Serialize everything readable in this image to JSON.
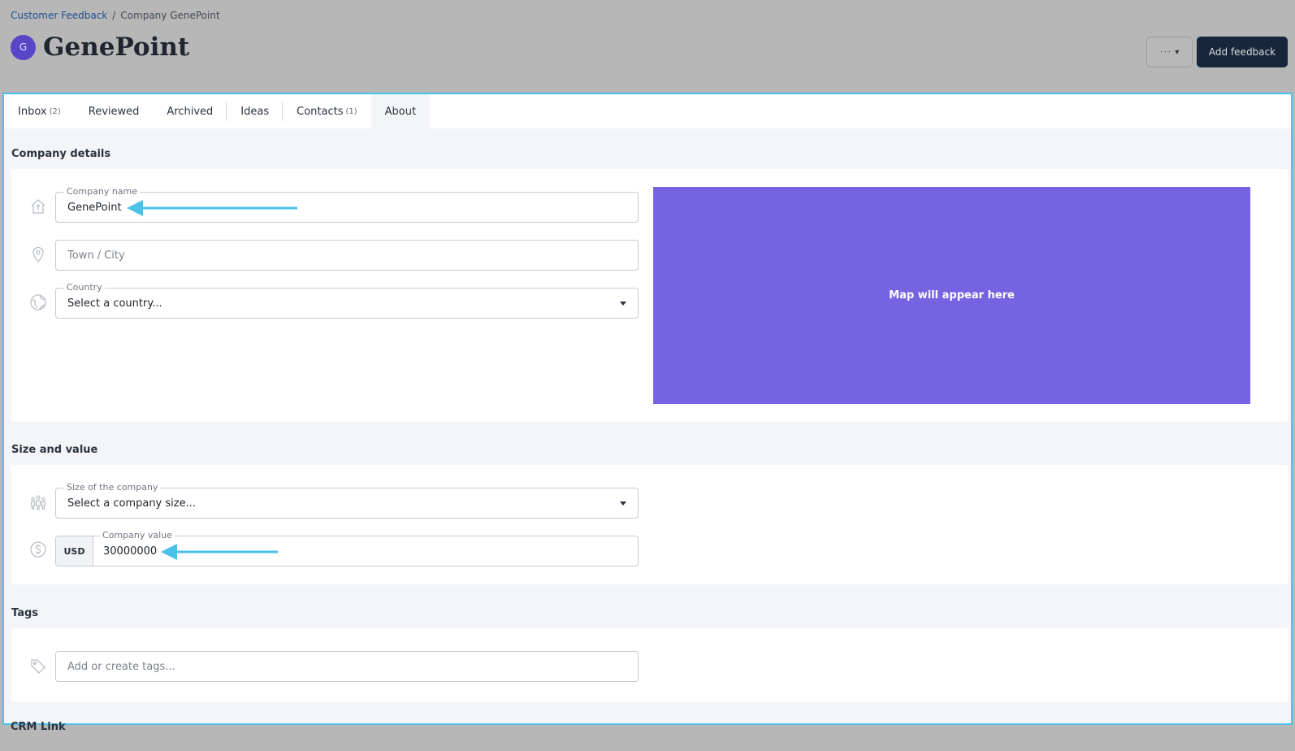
{
  "breadcrumb": {
    "parent": "Customer Feedback",
    "separator": "/",
    "current": "Company GenePoint"
  },
  "header": {
    "avatar_letter": "G",
    "title": "GenePoint",
    "add_button": "Add feedback"
  },
  "tabs": [
    {
      "label": "Inbox",
      "count": "(2)"
    },
    {
      "label": "Reviewed",
      "count": ""
    },
    {
      "label": "Archived",
      "count": ""
    },
    {
      "label": "Ideas",
      "count": ""
    },
    {
      "label": "Contacts",
      "count": "(1)"
    },
    {
      "label": "About",
      "count": ""
    }
  ],
  "company_details": {
    "title": "Company details",
    "company_name": {
      "label": "Company name",
      "value": "GenePoint"
    },
    "town": {
      "placeholder": "Town / City"
    },
    "country": {
      "label": "Country",
      "value": "Select a country..."
    },
    "map_text": "Map will appear here"
  },
  "size_value": {
    "title": "Size and value",
    "size": {
      "label": "Size of the company",
      "value": "Select a company size..."
    },
    "value": {
      "label": "Company value",
      "currency": "USD",
      "value": "30000000"
    }
  },
  "tags": {
    "title": "Tags",
    "placeholder": "Add or create tags..."
  },
  "crm": {
    "title": "CRM Link"
  },
  "colors": {
    "accent_arrow": "#4ac1e8",
    "map_bg": "#7663e2",
    "primary_button": "#17263a",
    "panel_border": "#4ac1e8"
  },
  "icons": [
    "house-icon",
    "location-pin-icon",
    "globe-icon",
    "people-icon",
    "dollar-icon",
    "tag-icon"
  ]
}
